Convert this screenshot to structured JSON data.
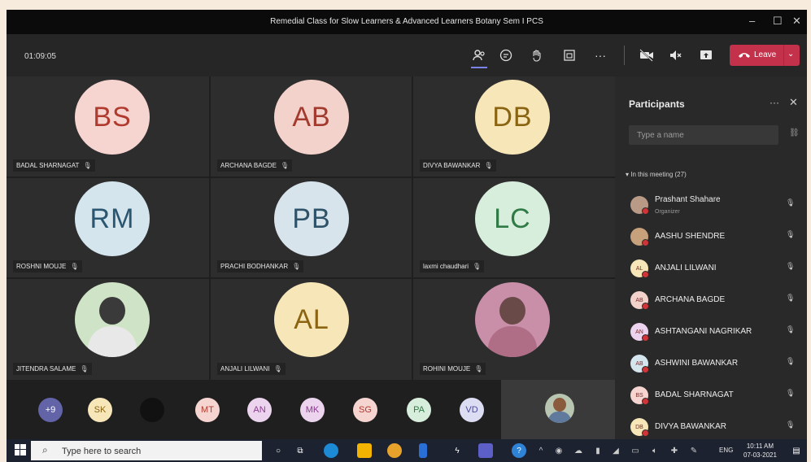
{
  "window": {
    "title": "Remedial Class for Slow Learners & Advanced Learners Botany Sem I PCS",
    "min": "–",
    "max": "☐",
    "close": "✕"
  },
  "toolbar": {
    "timer": "01:09:05",
    "leave_label": "Leave"
  },
  "tiles": [
    {
      "initials": "BS",
      "name": "BADAL SHARNAGAT",
      "bg": "#f6d4d0",
      "fg": "#b03a2e"
    },
    {
      "initials": "AB",
      "name": "ARCHANA BAGDE",
      "bg": "#f4d2cc",
      "fg": "#a23a2e"
    },
    {
      "initials": "DB",
      "name": "DIVYA BAWANKAR",
      "bg": "#f7e6b8",
      "fg": "#8a6410"
    },
    {
      "initials": "RM",
      "name": "ROSHNI MOUJE",
      "bg": "#d4e5ee",
      "fg": "#2b5670"
    },
    {
      "initials": "PB",
      "name": "PRACHI BODHANKAR",
      "bg": "#d7e4ec",
      "fg": "#2e5268"
    },
    {
      "initials": "LC",
      "name": "laxmi chaudhari",
      "bg": "#d8eedd",
      "fg": "#2f7a45"
    },
    {
      "initials": "",
      "name": "JITENDRA SALAME",
      "bg": "#cfe4c6",
      "fg": "#333"
    },
    {
      "initials": "AL",
      "name": "ANJALI LILWANI",
      "bg": "#f7e6b8",
      "fg": "#8a6410"
    },
    {
      "initials": "",
      "name": "ROHINI MOUJE",
      "bg": "#c98fa8",
      "fg": "#333"
    }
  ],
  "strip": [
    {
      "label": "+9",
      "bg": "#6264a7",
      "fg": "#ffffff"
    },
    {
      "label": "SK",
      "bg": "#f7e6b8",
      "fg": "#8a6410"
    },
    {
      "label": "",
      "bg": "#111111",
      "fg": "#ffffff"
    },
    {
      "label": "MT",
      "bg": "#f6d4d0",
      "fg": "#b03a2e"
    },
    {
      "label": "AN",
      "bg": "#ecd3ee",
      "fg": "#8b3a8f"
    },
    {
      "label": "MK",
      "bg": "#ecd3ee",
      "fg": "#8b3a8f"
    },
    {
      "label": "SG",
      "bg": "#f6d4d0",
      "fg": "#b03a2e"
    },
    {
      "label": "PA",
      "bg": "#d8eedd",
      "fg": "#2f7a45"
    },
    {
      "label": "VD",
      "bg": "#dcdcf2",
      "fg": "#4a4a9a"
    }
  ],
  "panel": {
    "title": "Participants",
    "search_placeholder": "Type a name",
    "section": "In this meeting (27)",
    "participants": [
      {
        "name": "Prashant Shahare",
        "role": "Organizer",
        "initials": "",
        "bg": "#b89a86"
      },
      {
        "name": "AASHU SHENDRE",
        "role": "",
        "initials": "",
        "bg": "#c7a07c"
      },
      {
        "name": "ANJALI LILWANI",
        "role": "",
        "initials": "AL",
        "bg": "#f7e6b8"
      },
      {
        "name": "ARCHANA BAGDE",
        "role": "",
        "initials": "AB",
        "bg": "#f4d2cc"
      },
      {
        "name": "ASHTANGANI NAGRIKAR",
        "role": "",
        "initials": "AN",
        "bg": "#ecd3ee"
      },
      {
        "name": "ASHWINI BAWANKAR",
        "role": "",
        "initials": "AB",
        "bg": "#d4e5ee"
      },
      {
        "name": "BADAL SHARNAGAT",
        "role": "",
        "initials": "BS",
        "bg": "#f6d4d0"
      },
      {
        "name": "DIVYA BAWANKAR",
        "role": "",
        "initials": "DB",
        "bg": "#f7e6b8"
      }
    ]
  },
  "taskbar": {
    "search_placeholder": "Type here to search",
    "lang": "ENG",
    "time": "10:11 AM",
    "date": "07-03-2021"
  }
}
